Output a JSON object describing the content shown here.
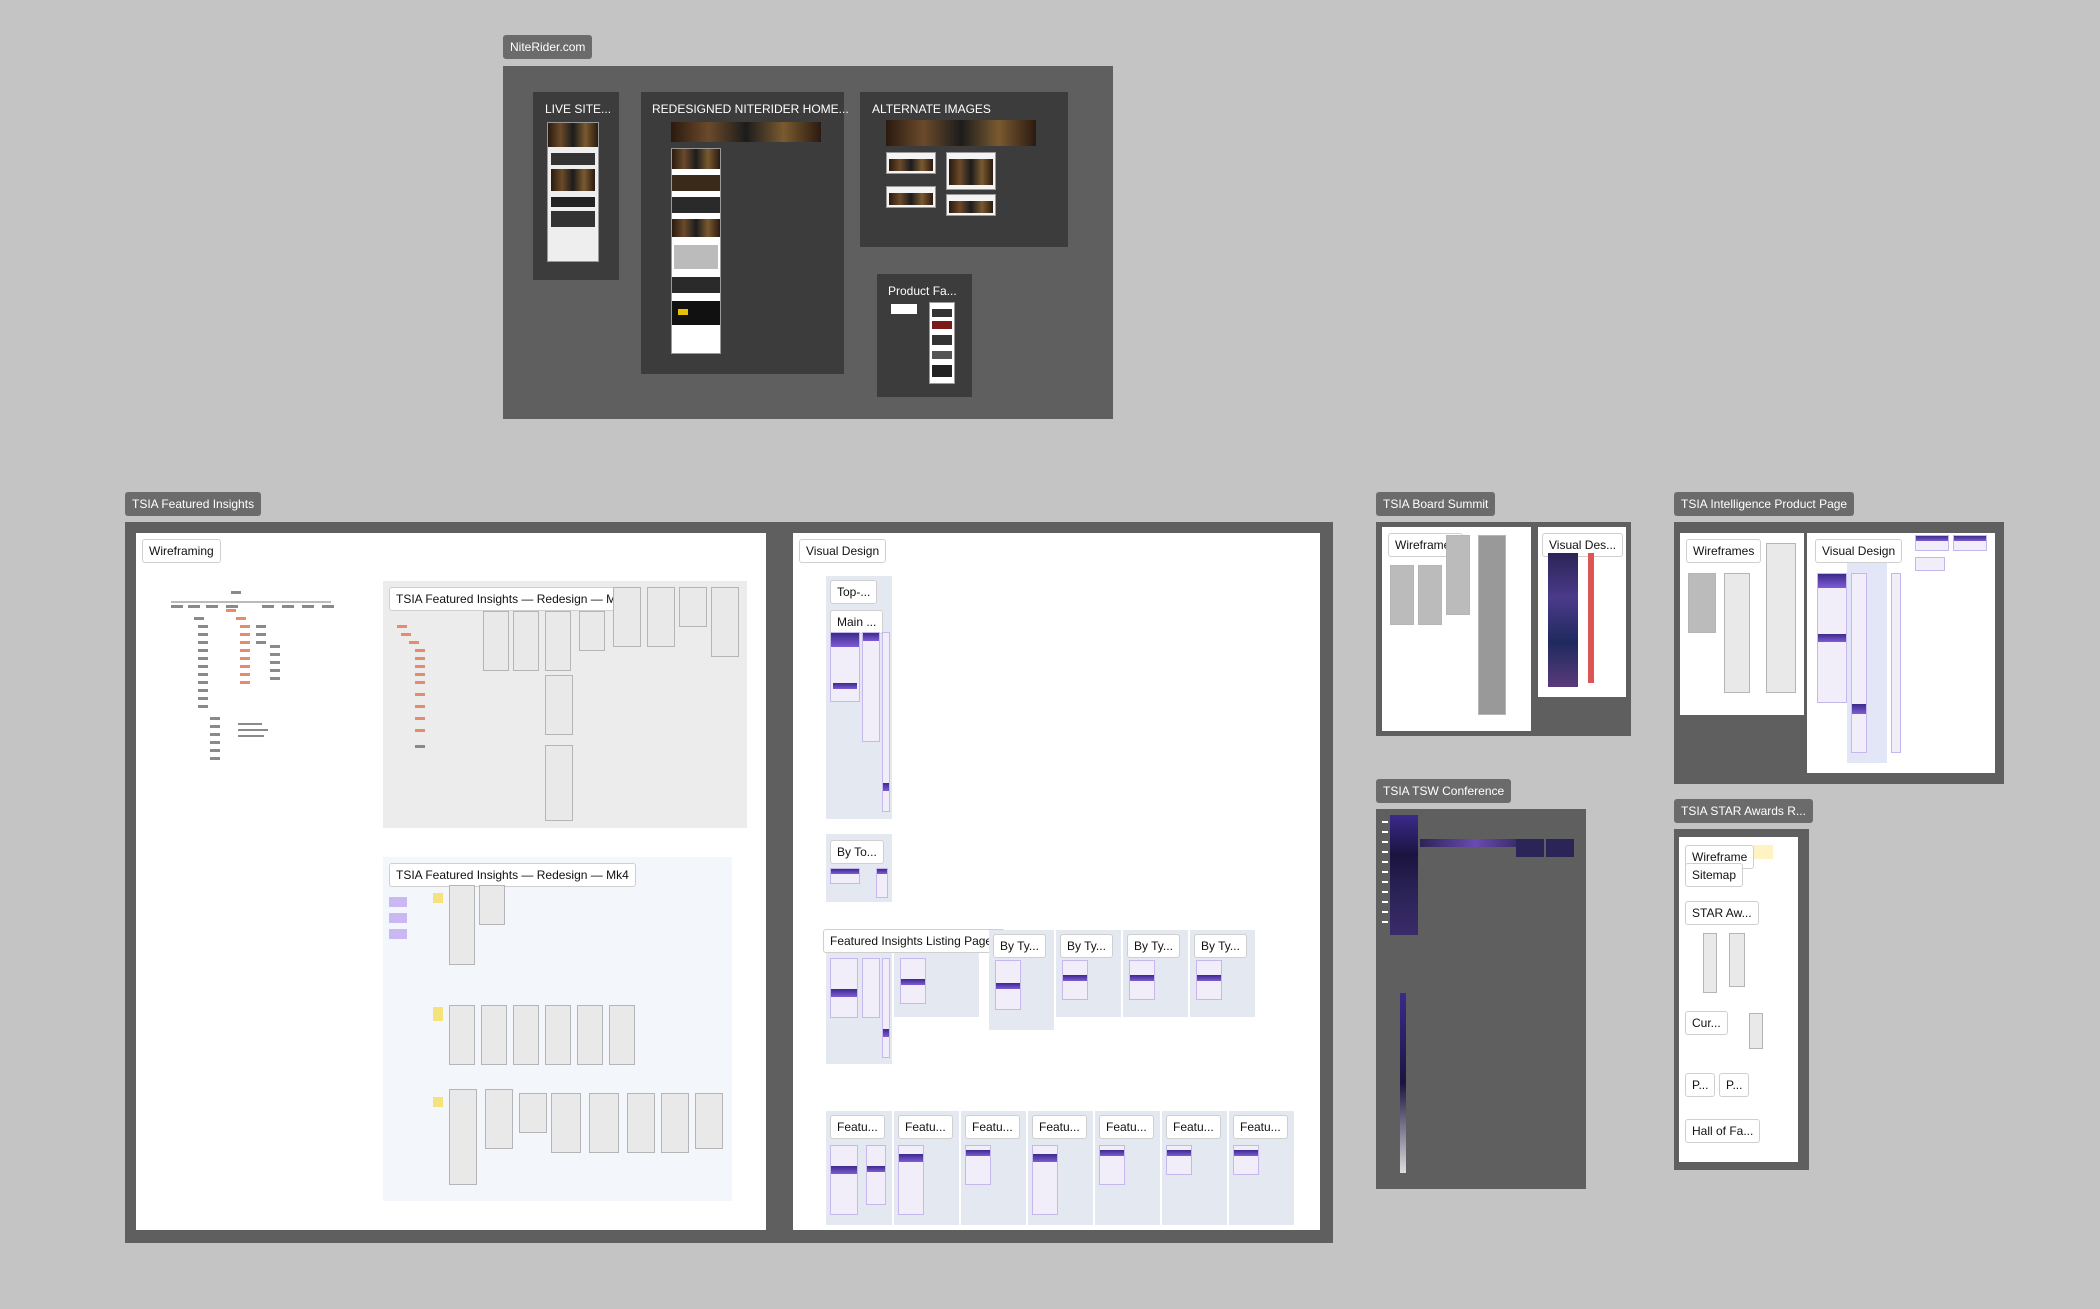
{
  "canvas": {
    "niterider": {
      "tag": "NiteRider.com",
      "frames": {
        "live_site": "LIVE SITE...",
        "redesigned": "REDESIGNED NITERIDER HOME...",
        "alternate": "ALTERNATE IMAGES",
        "product": "Product Fa..."
      }
    },
    "featured_insights": {
      "tag": "TSIA Featured Insights",
      "wireframing": {
        "label": "Wireframing",
        "mk1": "TSIA Featured Insights — Redesign — Mk1",
        "mk4": "TSIA Featured Insights — Redesign — Mk4"
      },
      "visual_design": {
        "label": "Visual Design",
        "top": "Top-...",
        "main": "Main ...",
        "by_topic": "By To...",
        "listing": "Featured Insights Listing Pages",
        "by_type": [
          "By Ty...",
          "By Ty...",
          "By Ty...",
          "By Ty..."
        ],
        "featu": [
          "Featu...",
          "Featu...",
          "Featu...",
          "Featu...",
          "Featu...",
          "Featu...",
          "Featu..."
        ]
      }
    },
    "board_summit": {
      "tag": "TSIA Board Summit",
      "wireframes": "Wireframes",
      "visual": "Visual Des..."
    },
    "tsw_conference": {
      "tag": "TSIA TSW Conference"
    },
    "intelligence": {
      "tag": "TSIA Intelligence Product Page",
      "wireframes": "Wireframes",
      "visual": "Visual Design"
    },
    "star_awards": {
      "tag": "TSIA STAR Awards R...",
      "items": {
        "wireframe": "Wireframe",
        "sitemap": "Sitemap",
        "star": "STAR Aw...",
        "cur": "Cur...",
        "p1": "P...",
        "p2": "P...",
        "hall": "Hall of Fa..."
      }
    }
  }
}
